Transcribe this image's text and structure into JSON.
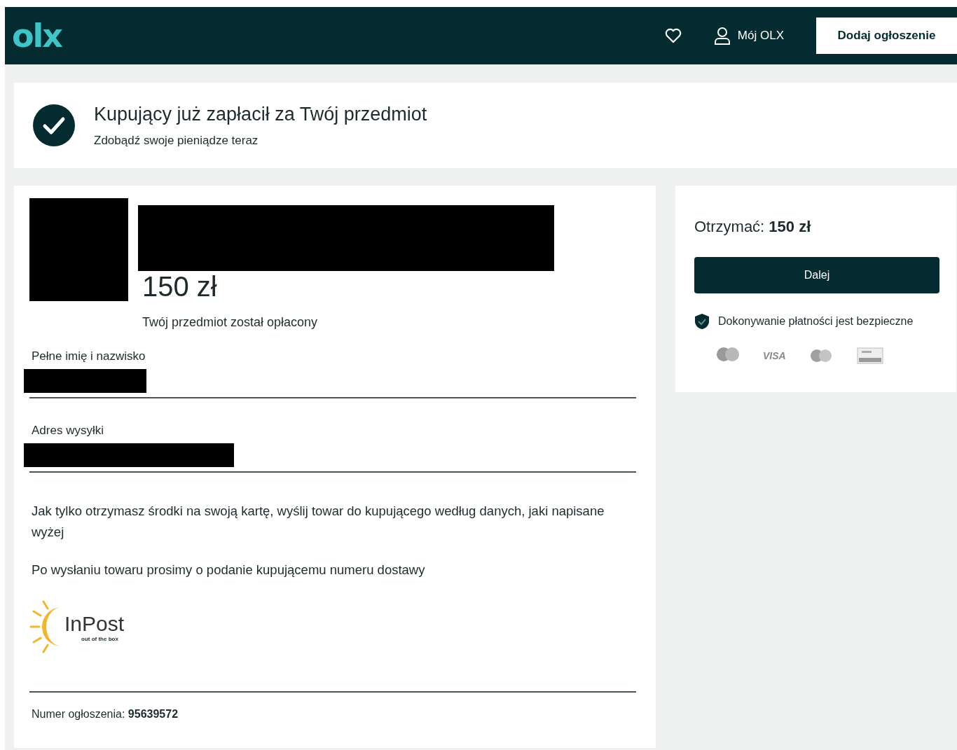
{
  "header": {
    "logo": "olx",
    "account_label": "Mój OLX",
    "add_button": "Dodaj ogłoszenie"
  },
  "banner": {
    "title": "Kupujący już zapłacił za Twój przedmiot",
    "subtitle": "Zdobądź swoje pieniądze teraz"
  },
  "item": {
    "price": "150 zł",
    "status": "Twój przedmiot został opłacony"
  },
  "fields": [
    {
      "label": "Pełne imię i nazwisko"
    },
    {
      "label": "Adres wysyłki"
    }
  ],
  "instructions": [
    "Jak tylko otrzymasz środki na swoją kartę, wyślij towar do kupującego według danych, jaki napisane wyżej",
    "Po wysłaniu towaru prosimy o podanie kupującemu numeru dostawy"
  ],
  "courier_logo": {
    "name": "InPost",
    "tagline": "out of the box"
  },
  "listing_number": {
    "label": "Numer ogłoszenia:",
    "value": "95639572"
  },
  "summary": {
    "label": "Otrzymać:",
    "amount": "150 zł",
    "button": "Dalej",
    "secure_note": "Dokonywanie płatności jest bezpieczne",
    "visa_label": "VISA"
  }
}
